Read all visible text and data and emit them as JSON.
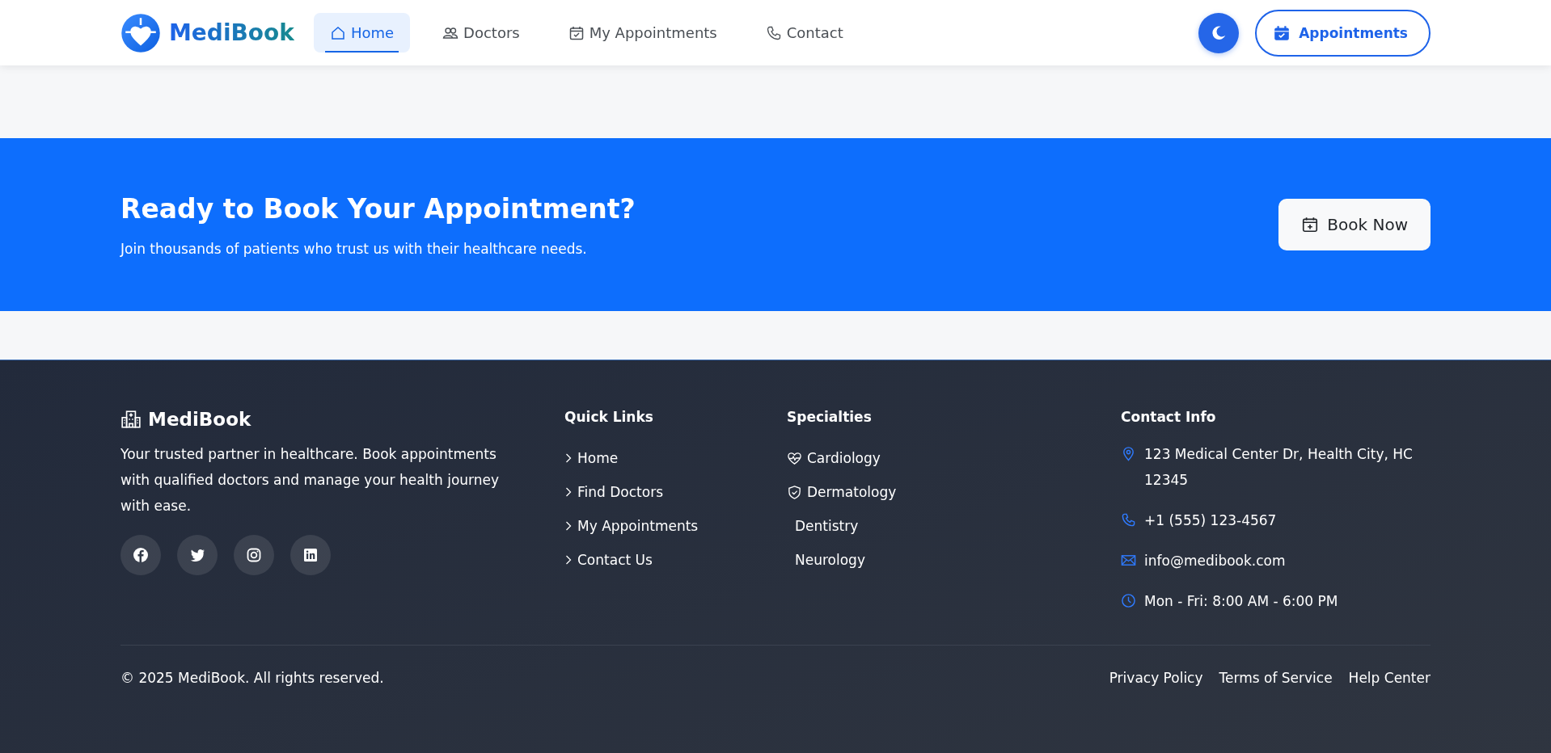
{
  "nav": {
    "brand": "MediBook",
    "links": [
      {
        "label": "Home",
        "kind": "home",
        "selected": true
      },
      {
        "label": "Doctors",
        "kind": "people",
        "selected": false
      },
      {
        "label": "My Appointments",
        "kind": "calendar",
        "selected": false
      },
      {
        "label": "Contact",
        "kind": "phone",
        "selected": false
      }
    ],
    "appointments_button": "Appointments"
  },
  "cta": {
    "title": "Ready to Book Your Appointment?",
    "subtitle": "Join thousands of patients who trust us with their healthcare needs.",
    "button": "Book Now"
  },
  "footer": {
    "brand": "MediBook",
    "description": "Your trusted partner in healthcare. Book appointments with qualified doctors and manage your health journey with ease.",
    "social": [
      {
        "kind": "facebook"
      },
      {
        "kind": "twitter"
      },
      {
        "kind": "instagram"
      },
      {
        "kind": "linkedin"
      }
    ],
    "quick_links": {
      "title": "Quick Links",
      "items": [
        "Home",
        "Find Doctors",
        "My Appointments",
        "Contact Us"
      ]
    },
    "specialties": {
      "title": "Specialties",
      "items": [
        {
          "label": "Cardiology",
          "kind": "heart"
        },
        {
          "label": "Dermatology",
          "kind": "shield"
        },
        {
          "label": "Dentistry",
          "kind": "plain"
        },
        {
          "label": "Neurology",
          "kind": "plain"
        }
      ]
    },
    "contact": {
      "title": "Contact Info",
      "items": [
        {
          "kind": "address",
          "text": "123 Medical Center Dr, Health City, HC 12345"
        },
        {
          "kind": "phone",
          "text": "+1 (555) 123-4567"
        },
        {
          "kind": "email",
          "text": "info@medibook.com"
        },
        {
          "kind": "hours",
          "text": "Mon - Fri: 8:00 AM - 6:00 PM"
        }
      ]
    },
    "copyright": "© 2025 MediBook. All rights reserved.",
    "legal_links": [
      "Privacy Policy",
      "Terms of Service",
      "Help Center"
    ]
  }
}
